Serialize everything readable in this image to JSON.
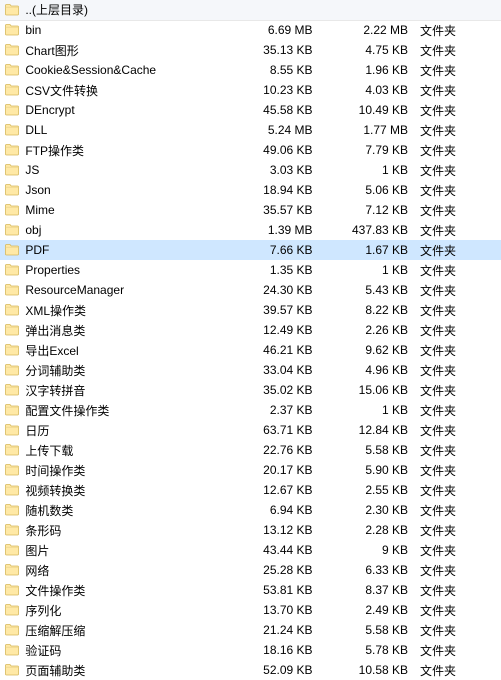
{
  "parent_dir": {
    "label": "..(上层目录)"
  },
  "type_label": "文件夹",
  "icons": {
    "folder": "folder-icon"
  },
  "rows": [
    {
      "name": "bin",
      "size1": "6.69 MB",
      "size2": "2.22 MB",
      "selected": false
    },
    {
      "name": "Chart图形",
      "size1": "35.13 KB",
      "size2": "4.75 KB",
      "selected": false
    },
    {
      "name": "Cookie&Session&Cache",
      "size1": "8.55 KB",
      "size2": "1.96 KB",
      "selected": false
    },
    {
      "name": "CSV文件转换",
      "size1": "10.23 KB",
      "size2": "4.03 KB",
      "selected": false
    },
    {
      "name": "DEncrypt",
      "size1": "45.58 KB",
      "size2": "10.49 KB",
      "selected": false
    },
    {
      "name": "DLL",
      "size1": "5.24 MB",
      "size2": "1.77 MB",
      "selected": false
    },
    {
      "name": "FTP操作类",
      "size1": "49.06 KB",
      "size2": "7.79 KB",
      "selected": false
    },
    {
      "name": "JS",
      "size1": "3.03 KB",
      "size2": "1 KB",
      "selected": false
    },
    {
      "name": "Json",
      "size1": "18.94 KB",
      "size2": "5.06 KB",
      "selected": false
    },
    {
      "name": "Mime",
      "size1": "35.57 KB",
      "size2": "7.12 KB",
      "selected": false
    },
    {
      "name": "obj",
      "size1": "1.39 MB",
      "size2": "437.83 KB",
      "selected": false
    },
    {
      "name": "PDF",
      "size1": "7.66 KB",
      "size2": "1.67 KB",
      "selected": true
    },
    {
      "name": "Properties",
      "size1": "1.35 KB",
      "size2": "1 KB",
      "selected": false
    },
    {
      "name": "ResourceManager",
      "size1": "24.30 KB",
      "size2": "5.43 KB",
      "selected": false
    },
    {
      "name": "XML操作类",
      "size1": "39.57 KB",
      "size2": "8.22 KB",
      "selected": false
    },
    {
      "name": "弹出消息类",
      "size1": "12.49 KB",
      "size2": "2.26 KB",
      "selected": false
    },
    {
      "name": "导出Excel",
      "size1": "46.21 KB",
      "size2": "9.62 KB",
      "selected": false
    },
    {
      "name": "分词辅助类",
      "size1": "33.04 KB",
      "size2": "4.96 KB",
      "selected": false
    },
    {
      "name": "汉字转拼音",
      "size1": "35.02 KB",
      "size2": "15.06 KB",
      "selected": false
    },
    {
      "name": "配置文件操作类",
      "size1": "2.37 KB",
      "size2": "1 KB",
      "selected": false
    },
    {
      "name": "日历",
      "size1": "63.71 KB",
      "size2": "12.84 KB",
      "selected": false
    },
    {
      "name": "上传下载",
      "size1": "22.76 KB",
      "size2": "5.58 KB",
      "selected": false
    },
    {
      "name": "时间操作类",
      "size1": "20.17 KB",
      "size2": "5.90 KB",
      "selected": false
    },
    {
      "name": "视频转换类",
      "size1": "12.67 KB",
      "size2": "2.55 KB",
      "selected": false
    },
    {
      "name": "随机数类",
      "size1": "6.94 KB",
      "size2": "2.30 KB",
      "selected": false
    },
    {
      "name": "条形码",
      "size1": "13.12 KB",
      "size2": "2.28 KB",
      "selected": false
    },
    {
      "name": "图片",
      "size1": "43.44 KB",
      "size2": "9 KB",
      "selected": false
    },
    {
      "name": "网络",
      "size1": "25.28 KB",
      "size2": "6.33 KB",
      "selected": false
    },
    {
      "name": "文件操作类",
      "size1": "53.81 KB",
      "size2": "8.37 KB",
      "selected": false
    },
    {
      "name": "序列化",
      "size1": "13.70 KB",
      "size2": "2.49 KB",
      "selected": false
    },
    {
      "name": "压缩解压缩",
      "size1": "21.24 KB",
      "size2": "5.58 KB",
      "selected": false
    },
    {
      "name": "验证码",
      "size1": "18.16 KB",
      "size2": "5.78 KB",
      "selected": false
    },
    {
      "name": "页面辅助类",
      "size1": "52.09 KB",
      "size2": "10.58 KB",
      "selected": false
    }
  ]
}
